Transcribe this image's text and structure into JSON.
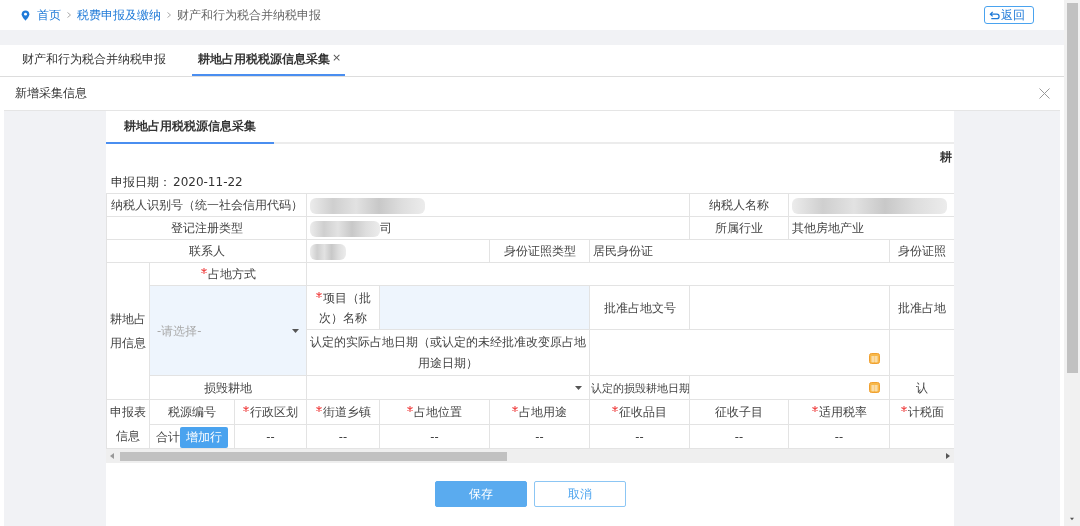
{
  "breadcrumb": [
    {
      "label": "首页",
      "kind": "home"
    },
    {
      "label": "税费申报及缴纳",
      "kind": "link"
    },
    {
      "label": "财产和行为税合并纳税申报",
      "kind": "current"
    }
  ],
  "back_button": {
    "label": "返回"
  },
  "tabs": [
    {
      "label": "财产和行为税合并纳税申报",
      "selected": false,
      "closable": false
    },
    {
      "label": "耕地占用税税源信息采集",
      "selected": true,
      "closable": true,
      "close_label": "×"
    }
  ],
  "dialog": {
    "title": "新增采集信息"
  },
  "form": {
    "tab": "耕地占用税税源信息采集",
    "heading": "耕",
    "date_label": "申报日期：",
    "date": "2020-11-22",
    "fields": {
      "taxpayer_id": {
        "label": "纳税人识别号（统一社会信用代码）",
        "redacted": true
      },
      "taxpayer_name": {
        "label": "纳税人名称",
        "redacted": true
      },
      "registration_type": {
        "label": "登记注册类型",
        "value": "司",
        "redacted": true
      },
      "industry": {
        "label": "所属行业",
        "value": "其他房地产业"
      },
      "contact": {
        "label": "联系人",
        "redacted": true
      },
      "id_type": {
        "label": "身份证照类型",
        "value": "居民身份证"
      },
      "id_number": {
        "label": "身份证照"
      }
    },
    "occupation": {
      "group_label": "耕地占用信息",
      "method": {
        "label": "占地方式",
        "required": true,
        "placeholder": "-请选择-"
      },
      "project_name": {
        "label": "项目（批次）名称",
        "required": true
      },
      "approval_no": {
        "label": "批准占地文号"
      },
      "approval_more": {
        "label": "批准占地"
      },
      "actual_date": {
        "label": "认定的实际占地日期（或认定的未经批准改变原占地用途日期）"
      },
      "damaged": {
        "label": "损毁耕地"
      },
      "damage_date": {
        "label": "认定的损毁耕地日期"
      },
      "damage_more": {
        "label": "认"
      }
    },
    "declaration": {
      "group_label": "申报表信息",
      "columns": [
        {
          "label": "税源编号",
          "required": false
        },
        {
          "label": "行政区划",
          "required": true
        },
        {
          "label": "街道乡镇",
          "required": true
        },
        {
          "label": "占地位置",
          "required": true
        },
        {
          "label": "占地用途",
          "required": true
        },
        {
          "label": "征收品目",
          "required": true
        },
        {
          "label": "征收子目",
          "required": false
        },
        {
          "label": "适用税率",
          "required": true
        },
        {
          "label": "计税面",
          "required": true
        }
      ],
      "total_label": "合计",
      "add_row_button": "增加行",
      "cells": [
        "--",
        "--",
        "--",
        "--",
        "--",
        "--",
        "--"
      ]
    }
  },
  "buttons": [
    {
      "label": "保存",
      "kind": "primary"
    },
    {
      "label": "取消",
      "kind": "secondary"
    }
  ]
}
